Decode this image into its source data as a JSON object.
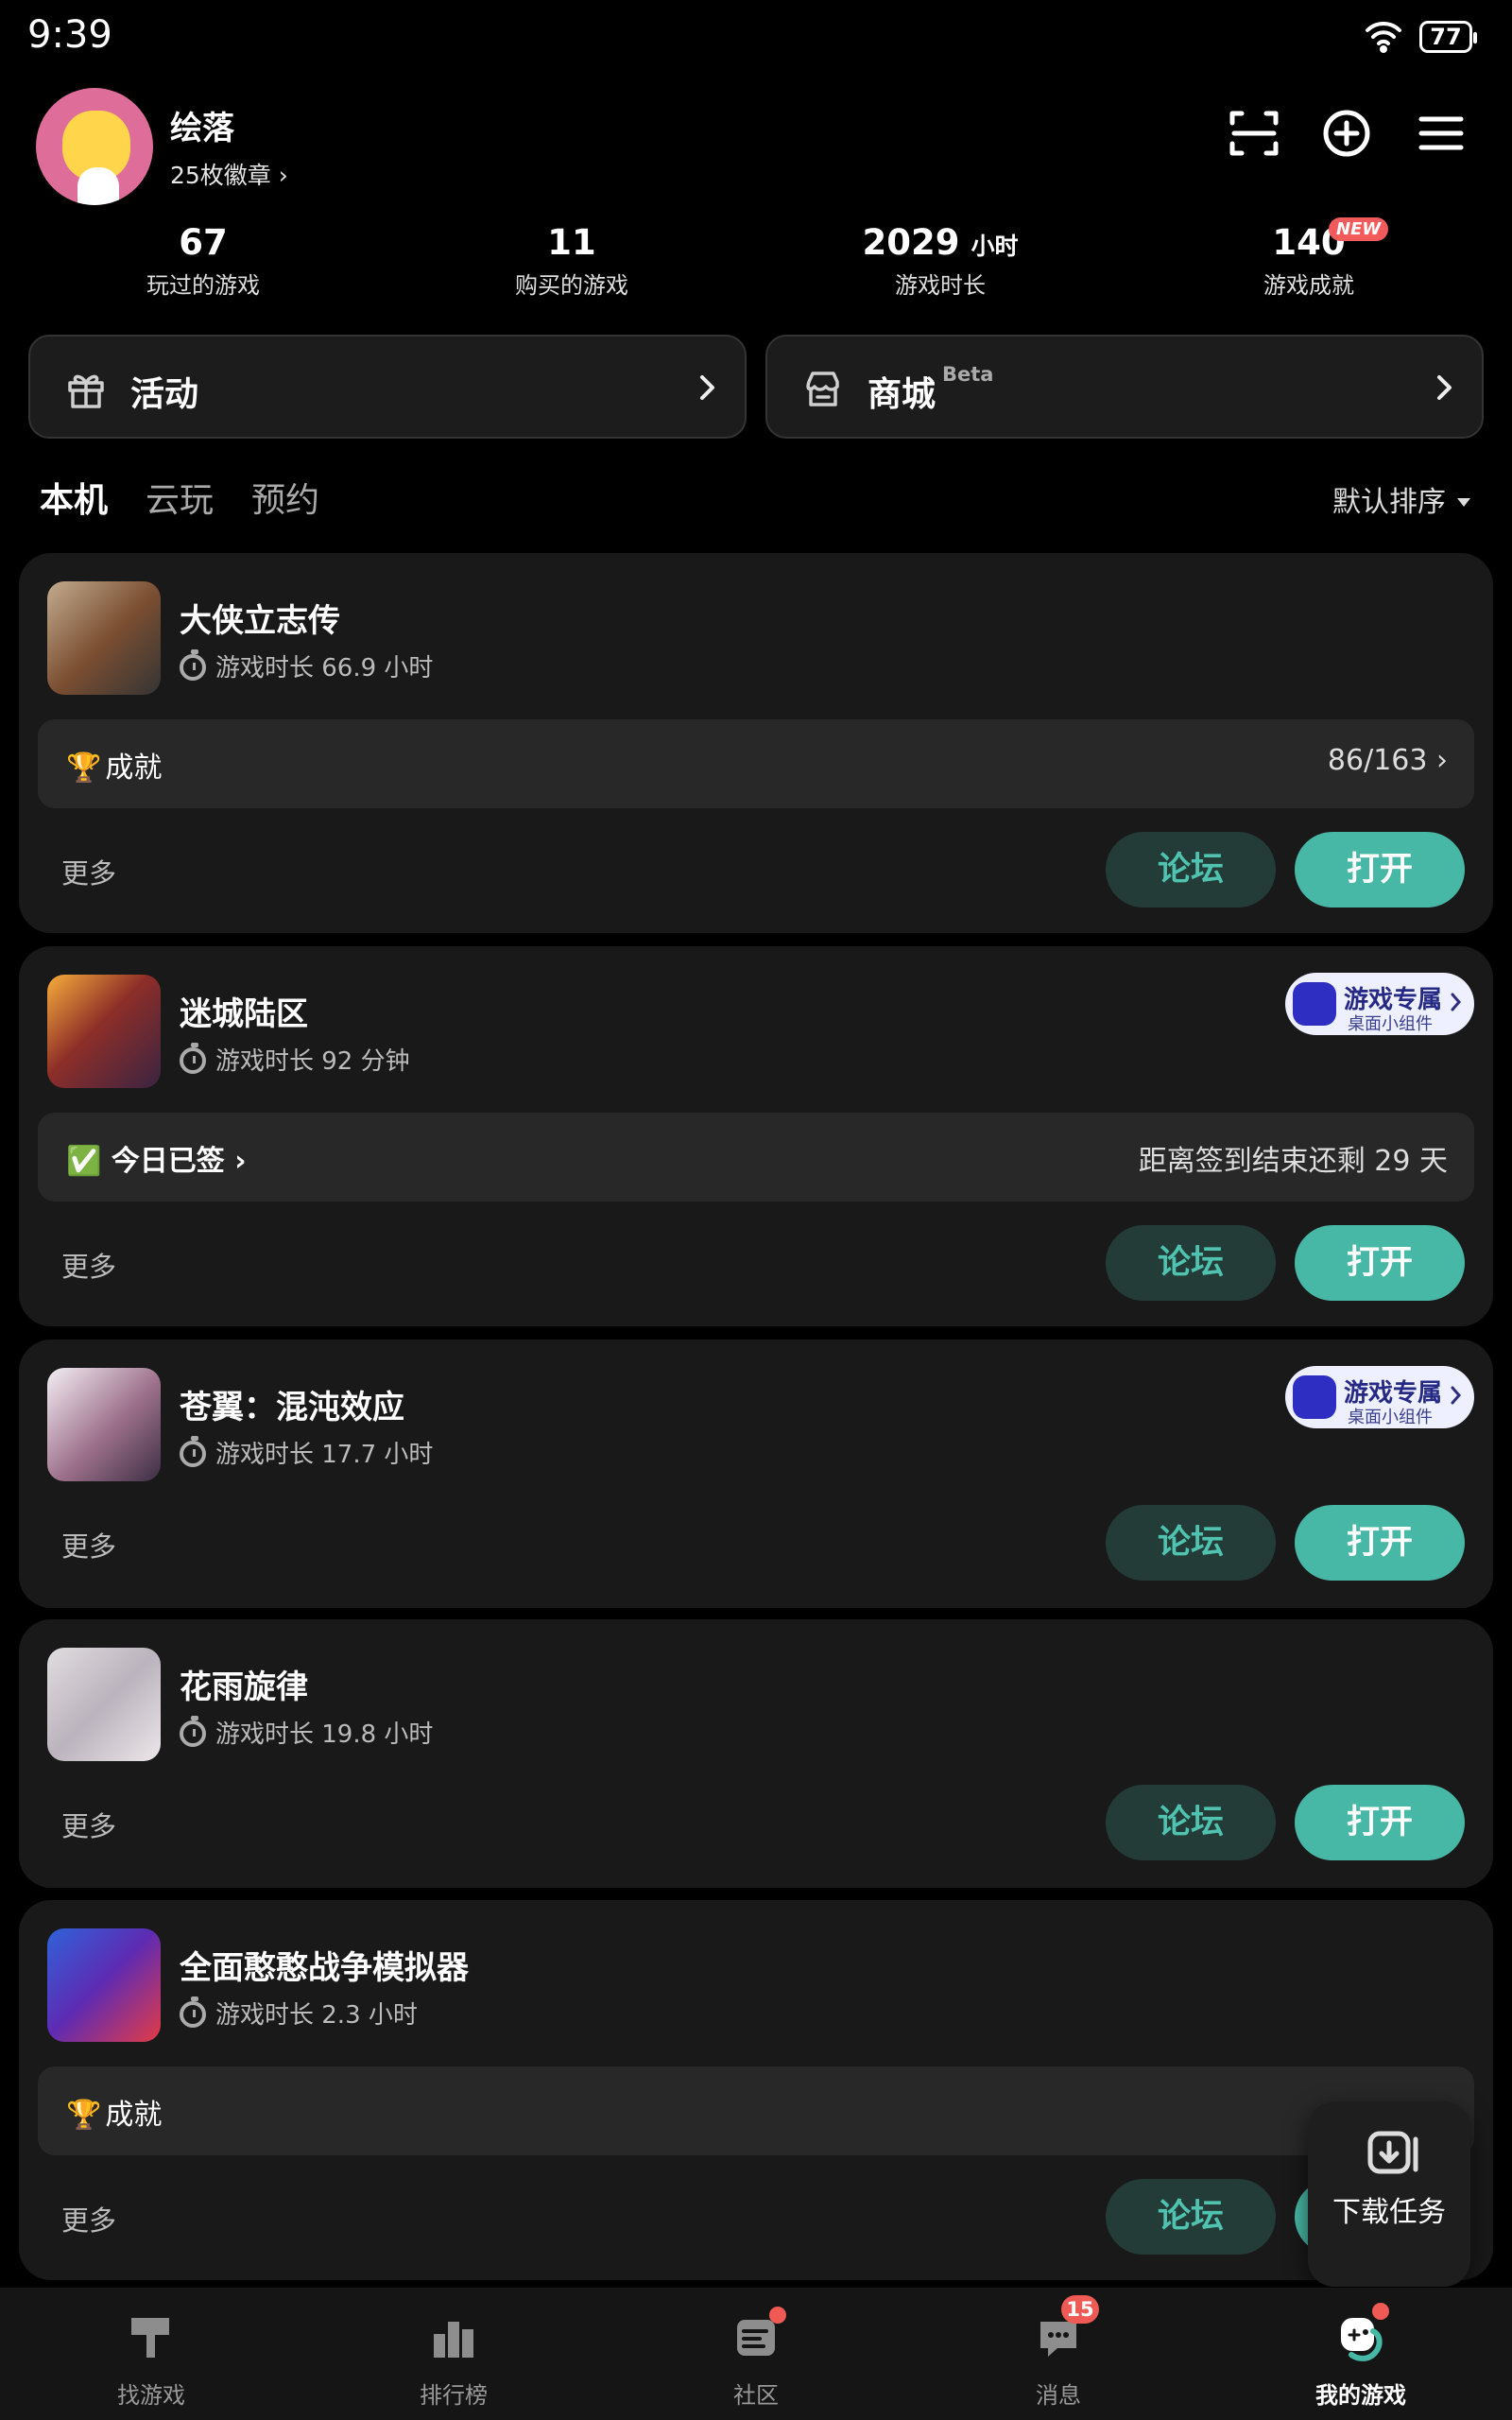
{
  "status_bar": {
    "time": "9:39",
    "battery": "77"
  },
  "profile": {
    "username": "绘落",
    "badges": "25枚徽章"
  },
  "stats": [
    {
      "value": "67",
      "label": "玩过的游戏"
    },
    {
      "value": "11",
      "label": "购买的游戏"
    },
    {
      "value": "2029",
      "unit": "小时",
      "label": "游戏时长"
    },
    {
      "value": "140",
      "label": "游戏成就",
      "badge": "NEW"
    }
  ],
  "actions": {
    "activity": "活动",
    "store": "商城",
    "store_beta": "Beta"
  },
  "tabs": {
    "local": "本机",
    "cloud": "云玩",
    "reserve": "预约",
    "sort": "默认排序"
  },
  "labels": {
    "more": "更多",
    "forum": "论坛",
    "open": "打开",
    "widget_title": "游戏专属",
    "widget_sub": "桌面小组件"
  },
  "games": [
    {
      "title": "大侠立志传",
      "playtime": "游戏时长 66.9 小时",
      "bar_label": "成就",
      "bar_right": "86/163"
    },
    {
      "title": "迷城陆区",
      "playtime": "游戏时长 92 分钟",
      "bar_label": "今日已签",
      "bar_right": "距离签到结束还剩 29 天"
    },
    {
      "title": "苍翼：混沌效应",
      "playtime": "游戏时长 17.7 小时"
    },
    {
      "title": "花雨旋律",
      "playtime": "游戏时长 19.8 小时"
    },
    {
      "title": "全面憨憨战争模拟器",
      "playtime": "游戏时长 2.3 小时",
      "bar_label": "成就"
    }
  ],
  "download": {
    "label": "下载任务"
  },
  "nav": {
    "find": "找游戏",
    "rank": "排行榜",
    "community": "社区",
    "messages": "消息",
    "messages_count": "15",
    "my_games": "我的游戏"
  },
  "colors": {
    "accent": "#48b8a6",
    "card": "#191919",
    "badge": "#ef5a54"
  }
}
